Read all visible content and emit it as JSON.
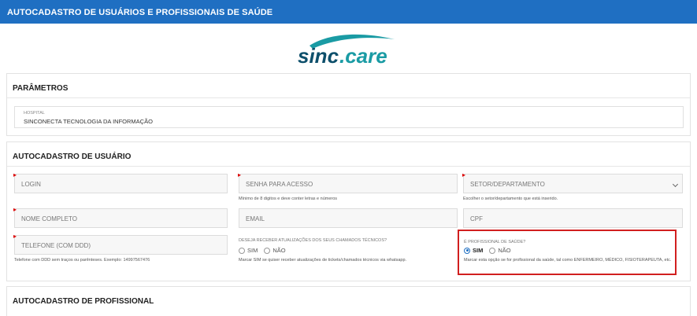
{
  "header": {
    "title": "AUTOCADASTRO DE USUÁRIOS E PROFISSIONAIS DE SAÚDE"
  },
  "logo": {
    "text": "SINC.CARE",
    "brand_colors": {
      "teal": "#1a9ba4",
      "navy": "#0d4f6b"
    }
  },
  "params": {
    "title": "PARÂMETROS",
    "hospital_label": "HOSPITAL",
    "hospital_value": "SINCONECTA TECNOLOGIA DA INFORMAÇÃO"
  },
  "user": {
    "title": "AUTOCADASTRO DE USUÁRIO",
    "login_placeholder": "LOGIN",
    "password_placeholder": "SENHA PARA ACESSO",
    "password_help": "Mínimo de 8 digitos e deve conter letras e números",
    "sector_placeholder": "SETOR/DEPARTAMENTO",
    "sector_help": "Escolher o setor/departamento que está inserido.",
    "fullname_placeholder": "NOME COMPLETO",
    "email_placeholder": "EMAIL",
    "cpf_placeholder": "CPF",
    "phone_placeholder": "TELEFONE (COM DDD)",
    "phone_help": "Telefone com DDD sem traços ou parênteses. Exemplo: 14997567476",
    "updates_question": "DESEJA RECEBER ATUALIZAÇÕES DOS SEUS CHAMADOS TÉCNICOS?",
    "updates_yes": "SIM",
    "updates_no": "NÃO",
    "updates_help": "Marcar SIM se quiser receber atualizações de tickets/chamados técnicos via whatsapp.",
    "health_question": "É PROFISSIONAL DE SAÚDE?",
    "health_yes": "SIM",
    "health_no": "NÃO",
    "health_selected": "SIM",
    "health_help": "Marcar esta opção se for profissional da saúde, tal como ENFERMEIRO, MÉDICO, FISIOTERAPEUTA, etc."
  },
  "professional": {
    "title": "AUTOCADASTRO DE PROFISSIONAL"
  },
  "colors": {
    "header_bg": "#1f6fc2",
    "highlight": "#d11f1f",
    "required": "#dd0000"
  }
}
